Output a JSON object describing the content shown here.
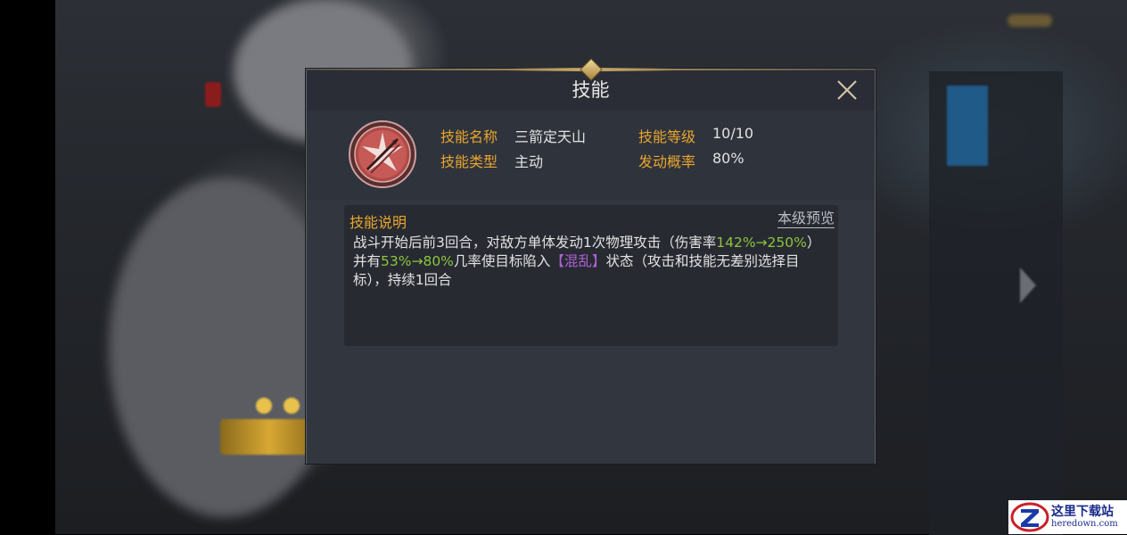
{
  "dialog": {
    "title": "技能",
    "skill": {
      "icon": "crossed-arrows-burst-icon",
      "name_label": "技能名称",
      "name_value": "三箭定天山",
      "level_label": "技能等级",
      "level_value": "10/10",
      "type_label": "技能类型",
      "type_value": "主动",
      "chance_label": "发动概率",
      "chance_value": "80%"
    },
    "description": {
      "label": "技能说明",
      "preview_link": "本级预览",
      "segments": [
        {
          "text": "战斗开始后前3回合，对敌方单体发动1次物理攻击（伤害率",
          "style": "normal"
        },
        {
          "text": "142%→250%",
          "style": "green"
        },
        {
          "text": "）并有",
          "style": "normal"
        },
        {
          "text": "53%→80%",
          "style": "green"
        },
        {
          "text": "几率使目标陷入",
          "style": "normal"
        },
        {
          "text": "【混乱】",
          "style": "purple"
        },
        {
          "text": "状态（攻击和技能无差别选择目标），持续1回合",
          "style": "normal"
        }
      ]
    }
  },
  "watermark": {
    "logo": "z-logo",
    "text_cn": "这里下载站",
    "text_en": "heredown.com"
  },
  "colors": {
    "label_orange": "#e8a52e",
    "highlight_green": "#8cc63e",
    "highlight_purple": "#b061d8"
  }
}
